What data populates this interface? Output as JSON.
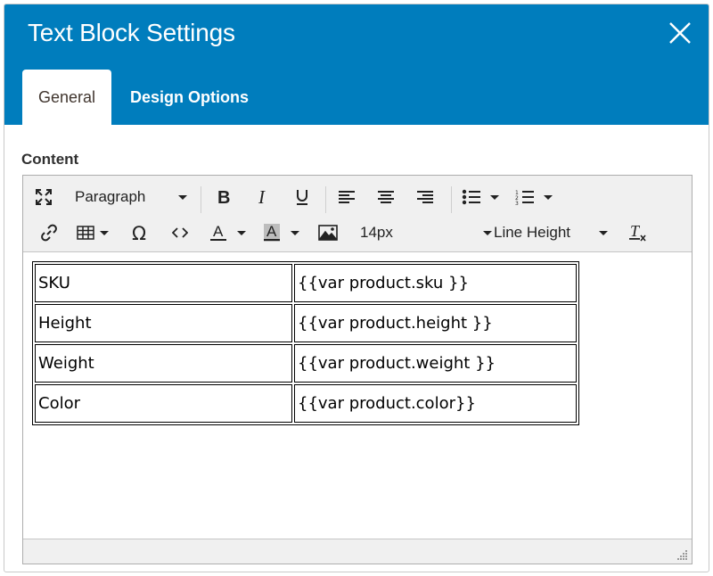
{
  "dialog": {
    "title": "Text Block Settings",
    "close_icon": "close-icon"
  },
  "tabs": [
    {
      "label": "General",
      "active": true
    },
    {
      "label": "Design Options",
      "active": false
    }
  ],
  "content": {
    "label": "Content"
  },
  "toolbar": {
    "row1": {
      "fullscreen_icon": "fullscreen-icon",
      "block_format": "Paragraph",
      "bold_icon": "bold-icon",
      "italic_icon": "italic-icon",
      "underline_icon": "underline-icon",
      "align_left_icon": "align-left-icon",
      "align_center_icon": "align-center-icon",
      "align_right_icon": "align-right-icon",
      "bullet_list_icon": "bullet-list-icon",
      "numbered_list_icon": "numbered-list-icon"
    },
    "row2": {
      "link_icon": "link-icon",
      "table_icon": "table-icon",
      "special_char_icon": "omega-icon",
      "source_code_icon": "code-icon",
      "text_color_icon": "text-color-icon",
      "background_color_icon": "background-color-icon",
      "image_icon": "image-icon",
      "font_size": "14px",
      "line_height": "Line Height",
      "clear_format_icon": "clear-formatting-icon"
    }
  },
  "colors": {
    "header_bg": "#007dbd",
    "toolbar_bg": "#f0f0f0"
  },
  "table": {
    "rows": [
      {
        "label": "SKU",
        "value": "{{var product.sku }}"
      },
      {
        "label": "Height",
        "value": "{{var product.height }}"
      },
      {
        "label": "Weight",
        "value": "{{var product.weight }}"
      },
      {
        "label": "Color",
        "value": "{{var product.color}}"
      }
    ]
  }
}
